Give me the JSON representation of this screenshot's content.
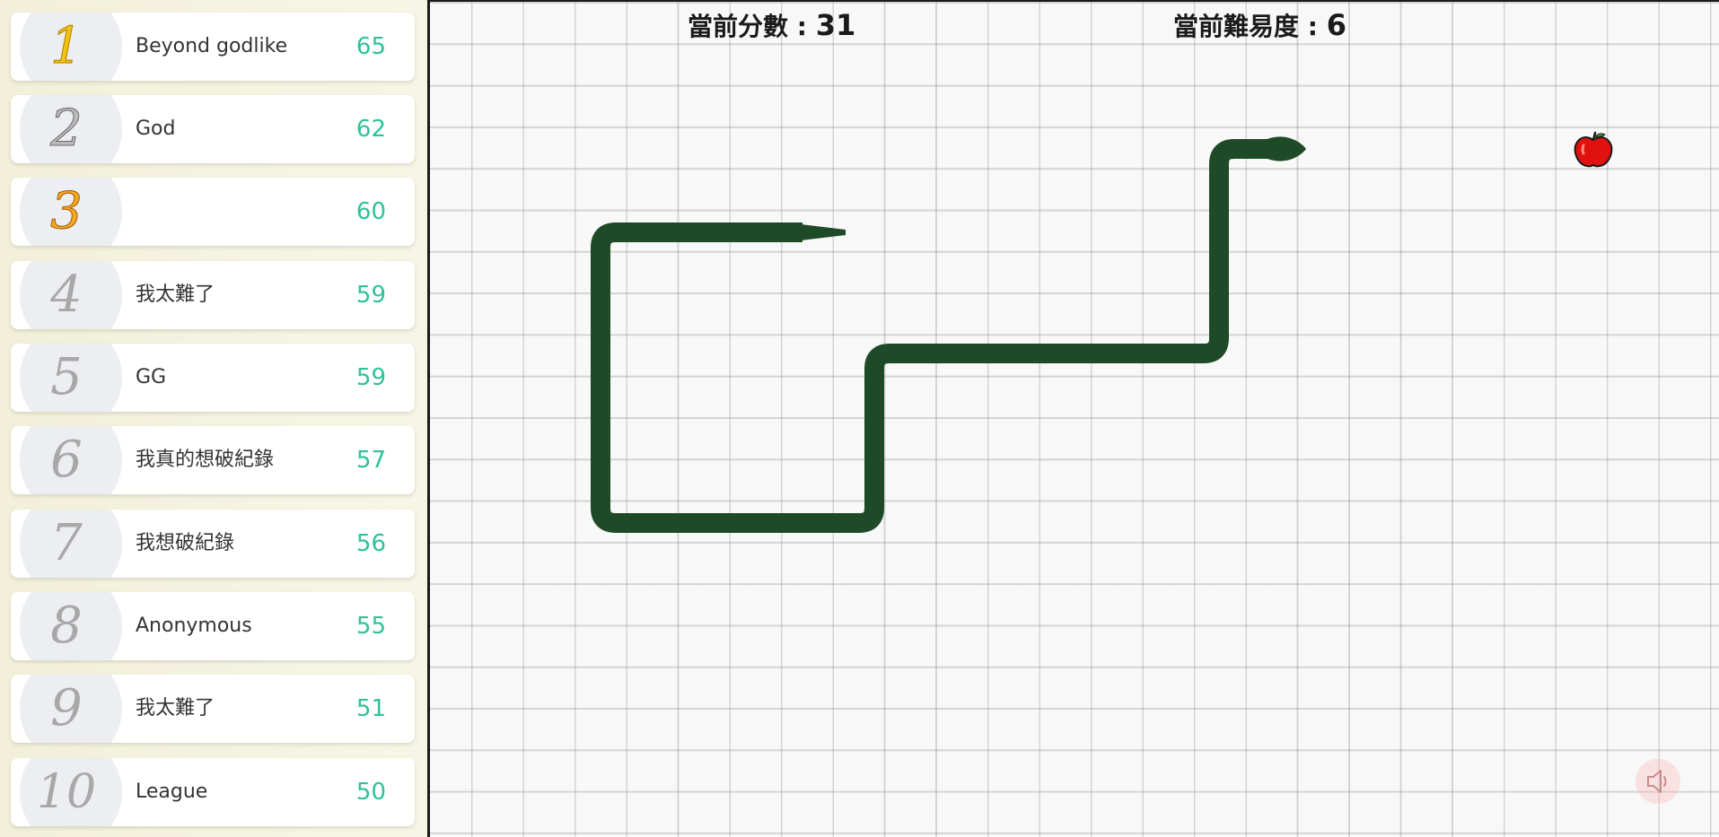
{
  "leaderboard": [
    {
      "rank": "1",
      "name": "Beyond godlike",
      "score": "65"
    },
    {
      "rank": "2",
      "name": "God",
      "score": "62"
    },
    {
      "rank": "3",
      "name": "",
      "score": "60"
    },
    {
      "rank": "4",
      "name": "我太難了",
      "score": "59"
    },
    {
      "rank": "5",
      "name": "GG",
      "score": "59"
    },
    {
      "rank": "6",
      "name": "我真的想破紀錄",
      "score": "57"
    },
    {
      "rank": "7",
      "name": "我想破紀錄",
      "score": "56"
    },
    {
      "rank": "8",
      "name": "Anonymous",
      "score": "55"
    },
    {
      "rank": "9",
      "name": "我太難了",
      "score": "51"
    },
    {
      "rank": "10",
      "name": "League",
      "score": "50"
    }
  ],
  "hud": {
    "score_label": "當前分數 : ",
    "score_value": "31",
    "difficulty_label": "當前難易度 : ",
    "difficulty_value": "6"
  },
  "icons": {
    "food": "apple-icon",
    "sound": "speaker-icon"
  },
  "colors": {
    "snake": "#1f4a27",
    "score_text": "#2ec29a",
    "gold": "#f1c40f",
    "silver": "#b9b9b9",
    "bronze": "#f7a823",
    "sound_button_bg": "#ffb6b6"
  }
}
